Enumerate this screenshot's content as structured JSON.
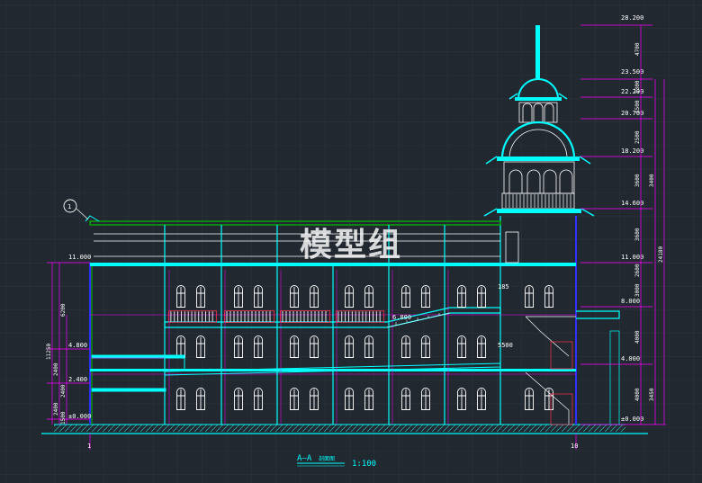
{
  "watermark": "模型组",
  "title": {
    "section": "A—A",
    "label": "剖面图",
    "scale": "1:100"
  },
  "axes": {
    "left": "1",
    "right": "10",
    "bubble": "1"
  },
  "right_levels": [
    "28.200",
    "23.500",
    "22.200",
    "20.700",
    "18.200",
    "14.600",
    "11.000",
    "8.000",
    "4.000",
    "±0.000"
  ],
  "left_levels": [
    "11.000",
    "4.800",
    "2.400",
    "±0.000"
  ],
  "inner_levels": [
    "6.800",
    "185",
    "5500"
  ],
  "right_dims": [
    "4700",
    "1300",
    "1500",
    "2500",
    "3600",
    "3600",
    "2600",
    "3000",
    "4000",
    "4000",
    "3450"
  ],
  "right_totals": [
    "24180",
    "3400"
  ],
  "left_dims": [
    "6200",
    "2400",
    "2400",
    "2400",
    "1500"
  ],
  "left_totals": [
    "11250"
  ],
  "colors": {
    "background": "#212830",
    "cyan": "#00ffff",
    "blue": "#3030ff",
    "green": "#00c000",
    "magenta": "#ff00ff",
    "white": "#ffffff"
  }
}
